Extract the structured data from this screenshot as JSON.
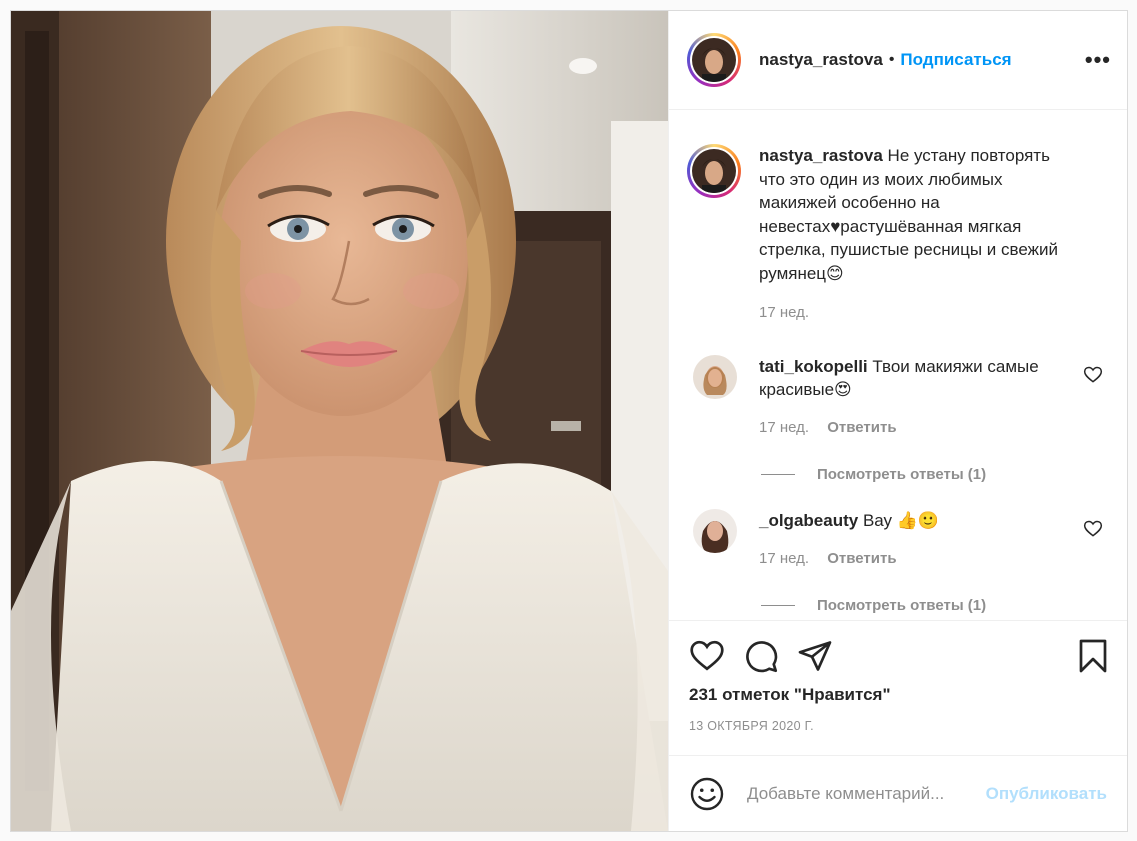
{
  "post": {
    "author": "nastya_rastova",
    "separator": "•",
    "follow_label": "Подписаться",
    "more_label": "•••"
  },
  "caption": {
    "username": "nastya_rastova",
    "text": "Не устану повторять что это один из моих любимых макияжей особенно на невестах♥растушёванная мягкая стрелка, пушистые ресницы и свежий румянец😊",
    "time": "17 нед."
  },
  "comments": [
    {
      "username": "tati_kokopelli",
      "text": "Твои макияжи самые красивые😍",
      "time": "17 нед.",
      "reply_label": "Ответить",
      "view_replies": "Посмотреть ответы (1)"
    },
    {
      "username": "_olgabeauty",
      "text": "Вау 👍🙂",
      "time": "17 нед.",
      "reply_label": "Ответить",
      "view_replies": "Посмотреть ответы (1)"
    }
  ],
  "actions": {
    "like_icon": "heart-icon",
    "comment_icon": "comment-icon",
    "share_icon": "paper-plane-icon",
    "save_icon": "bookmark-icon"
  },
  "likes_text": "231 отметок \"Нравится\"",
  "date_text": "13 ОКТЯБРЯ 2020 Г.",
  "add_comment": {
    "emoji_icon": "smiley-icon",
    "placeholder": "Добавьте комментарий...",
    "publish_label": "Опубликовать"
  },
  "colors": {
    "accent": "#0095f6",
    "publish_disabled": "#b2dffc",
    "secondary_text": "#8e8e8e"
  }
}
